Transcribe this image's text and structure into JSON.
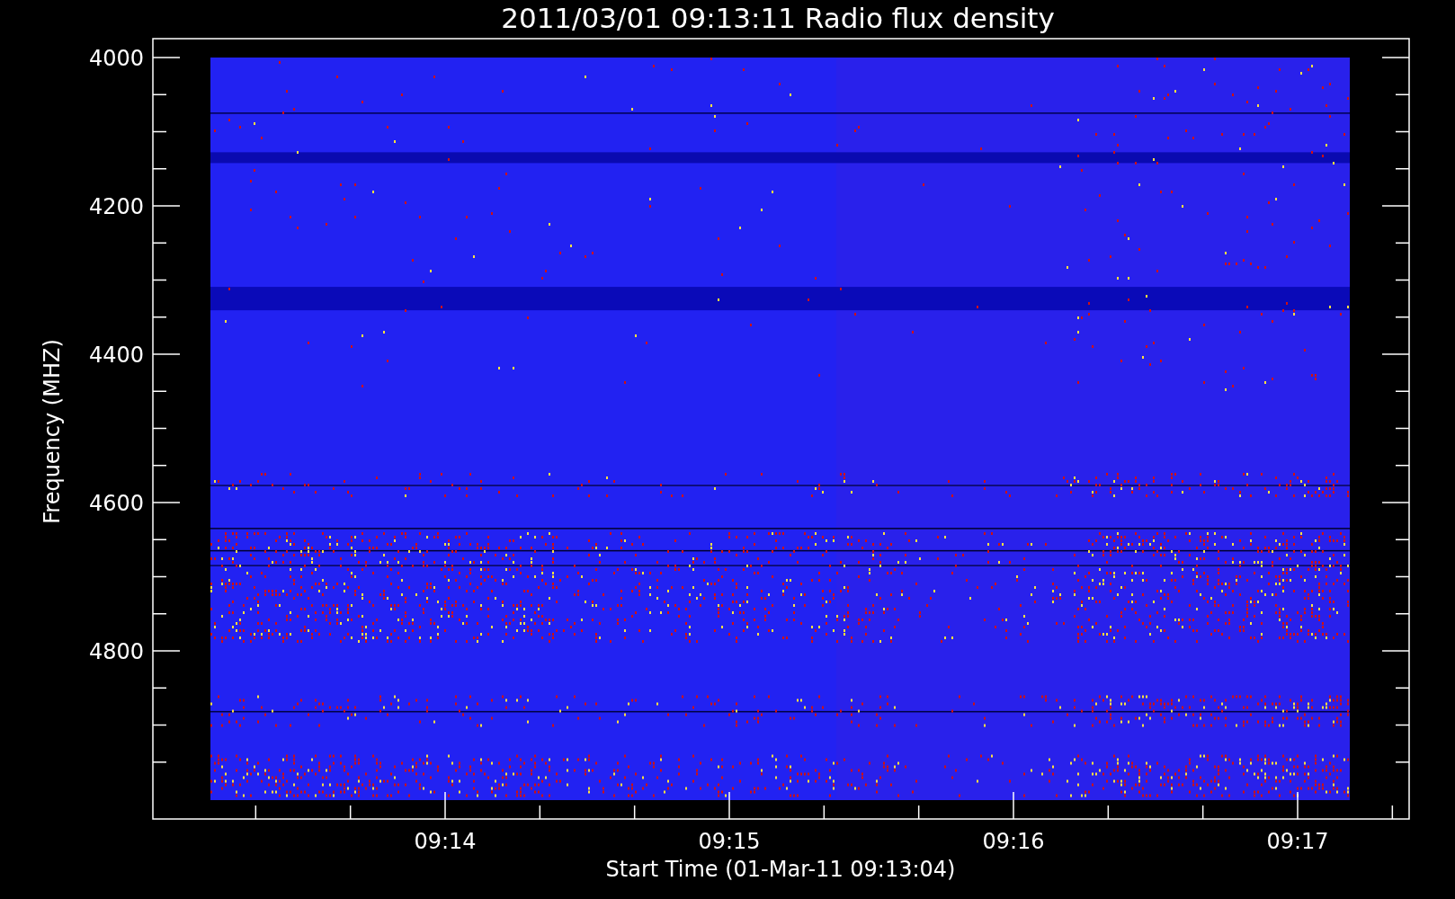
{
  "title": "2011/03/01 09:13:11 Radio flux density",
  "chart": {
    "ylabel": "Frequency (MHZ)",
    "xlabel": "Start Time (01-Mar-11 09:13:04)",
    "yticks": [
      "4000",
      "4200",
      "4400",
      "4600",
      "4800"
    ],
    "xticks": [
      "09:14",
      "09:15",
      "09:16",
      "09:17"
    ]
  }
}
